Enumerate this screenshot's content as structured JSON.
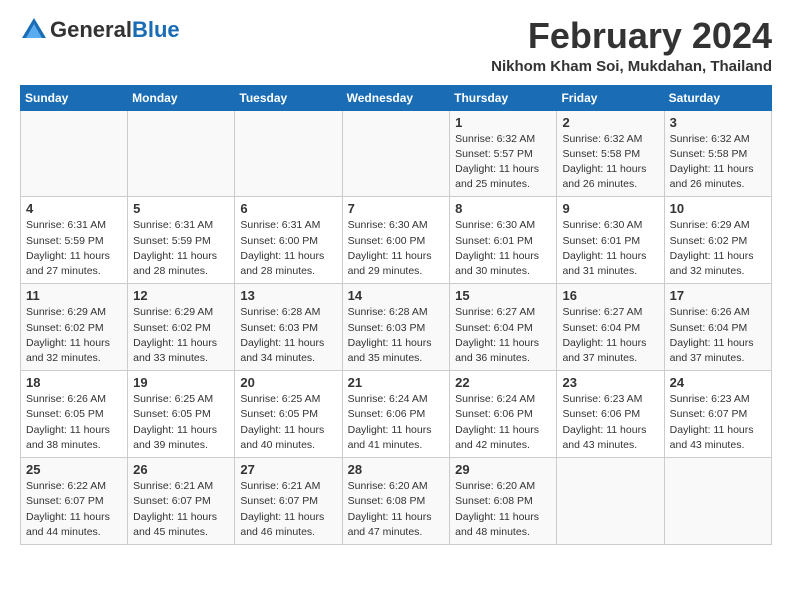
{
  "logo": {
    "general": "General",
    "blue": "Blue"
  },
  "title": "February 2024",
  "location": "Nikhom Kham Soi, Mukdahan, Thailand",
  "weekdays": [
    "Sunday",
    "Monday",
    "Tuesday",
    "Wednesday",
    "Thursday",
    "Friday",
    "Saturday"
  ],
  "weeks": [
    [
      {
        "day": "",
        "info": ""
      },
      {
        "day": "",
        "info": ""
      },
      {
        "day": "",
        "info": ""
      },
      {
        "day": "",
        "info": ""
      },
      {
        "day": "1",
        "info": "Sunrise: 6:32 AM\nSunset: 5:57 PM\nDaylight: 11 hours\nand 25 minutes."
      },
      {
        "day": "2",
        "info": "Sunrise: 6:32 AM\nSunset: 5:58 PM\nDaylight: 11 hours\nand 26 minutes."
      },
      {
        "day": "3",
        "info": "Sunrise: 6:32 AM\nSunset: 5:58 PM\nDaylight: 11 hours\nand 26 minutes."
      }
    ],
    [
      {
        "day": "4",
        "info": "Sunrise: 6:31 AM\nSunset: 5:59 PM\nDaylight: 11 hours\nand 27 minutes."
      },
      {
        "day": "5",
        "info": "Sunrise: 6:31 AM\nSunset: 5:59 PM\nDaylight: 11 hours\nand 28 minutes."
      },
      {
        "day": "6",
        "info": "Sunrise: 6:31 AM\nSunset: 6:00 PM\nDaylight: 11 hours\nand 28 minutes."
      },
      {
        "day": "7",
        "info": "Sunrise: 6:30 AM\nSunset: 6:00 PM\nDaylight: 11 hours\nand 29 minutes."
      },
      {
        "day": "8",
        "info": "Sunrise: 6:30 AM\nSunset: 6:01 PM\nDaylight: 11 hours\nand 30 minutes."
      },
      {
        "day": "9",
        "info": "Sunrise: 6:30 AM\nSunset: 6:01 PM\nDaylight: 11 hours\nand 31 minutes."
      },
      {
        "day": "10",
        "info": "Sunrise: 6:29 AM\nSunset: 6:02 PM\nDaylight: 11 hours\nand 32 minutes."
      }
    ],
    [
      {
        "day": "11",
        "info": "Sunrise: 6:29 AM\nSunset: 6:02 PM\nDaylight: 11 hours\nand 32 minutes."
      },
      {
        "day": "12",
        "info": "Sunrise: 6:29 AM\nSunset: 6:02 PM\nDaylight: 11 hours\nand 33 minutes."
      },
      {
        "day": "13",
        "info": "Sunrise: 6:28 AM\nSunset: 6:03 PM\nDaylight: 11 hours\nand 34 minutes."
      },
      {
        "day": "14",
        "info": "Sunrise: 6:28 AM\nSunset: 6:03 PM\nDaylight: 11 hours\nand 35 minutes."
      },
      {
        "day": "15",
        "info": "Sunrise: 6:27 AM\nSunset: 6:04 PM\nDaylight: 11 hours\nand 36 minutes."
      },
      {
        "day": "16",
        "info": "Sunrise: 6:27 AM\nSunset: 6:04 PM\nDaylight: 11 hours\nand 37 minutes."
      },
      {
        "day": "17",
        "info": "Sunrise: 6:26 AM\nSunset: 6:04 PM\nDaylight: 11 hours\nand 37 minutes."
      }
    ],
    [
      {
        "day": "18",
        "info": "Sunrise: 6:26 AM\nSunset: 6:05 PM\nDaylight: 11 hours\nand 38 minutes."
      },
      {
        "day": "19",
        "info": "Sunrise: 6:25 AM\nSunset: 6:05 PM\nDaylight: 11 hours\nand 39 minutes."
      },
      {
        "day": "20",
        "info": "Sunrise: 6:25 AM\nSunset: 6:05 PM\nDaylight: 11 hours\nand 40 minutes."
      },
      {
        "day": "21",
        "info": "Sunrise: 6:24 AM\nSunset: 6:06 PM\nDaylight: 11 hours\nand 41 minutes."
      },
      {
        "day": "22",
        "info": "Sunrise: 6:24 AM\nSunset: 6:06 PM\nDaylight: 11 hours\nand 42 minutes."
      },
      {
        "day": "23",
        "info": "Sunrise: 6:23 AM\nSunset: 6:06 PM\nDaylight: 11 hours\nand 43 minutes."
      },
      {
        "day": "24",
        "info": "Sunrise: 6:23 AM\nSunset: 6:07 PM\nDaylight: 11 hours\nand 43 minutes."
      }
    ],
    [
      {
        "day": "25",
        "info": "Sunrise: 6:22 AM\nSunset: 6:07 PM\nDaylight: 11 hours\nand 44 minutes."
      },
      {
        "day": "26",
        "info": "Sunrise: 6:21 AM\nSunset: 6:07 PM\nDaylight: 11 hours\nand 45 minutes."
      },
      {
        "day": "27",
        "info": "Sunrise: 6:21 AM\nSunset: 6:07 PM\nDaylight: 11 hours\nand 46 minutes."
      },
      {
        "day": "28",
        "info": "Sunrise: 6:20 AM\nSunset: 6:08 PM\nDaylight: 11 hours\nand 47 minutes."
      },
      {
        "day": "29",
        "info": "Sunrise: 6:20 AM\nSunset: 6:08 PM\nDaylight: 11 hours\nand 48 minutes."
      },
      {
        "day": "",
        "info": ""
      },
      {
        "day": "",
        "info": ""
      }
    ]
  ]
}
